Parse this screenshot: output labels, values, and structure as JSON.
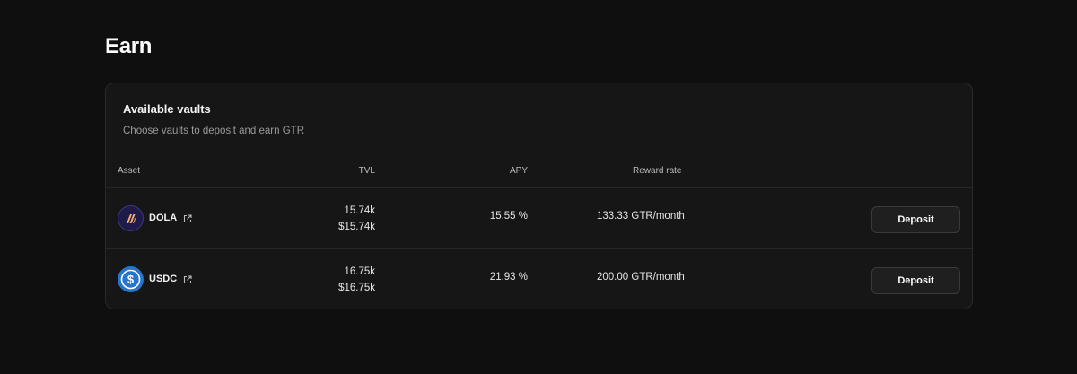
{
  "page": {
    "title": "Earn"
  },
  "vaults": {
    "title": "Available vaults",
    "subtitle": "Choose vaults to deposit and earn GTR",
    "columns": {
      "asset": "Asset",
      "tvl": "TVL",
      "apy": "APY",
      "reward_rate": "Reward rate"
    },
    "rows": [
      {
        "asset": "DOLA",
        "icon": "dola-token-icon",
        "tvl_amount": "15.74k",
        "tvl_usd": "$15.74k",
        "apy": "15.55 %",
        "reward_rate": "133.33 GTR/month",
        "action_label": "Deposit"
      },
      {
        "asset": "USDC",
        "icon": "usdc-token-icon",
        "tvl_amount": "16.75k",
        "tvl_usd": "$16.75k",
        "apy": "21.93 %",
        "reward_rate": "200.00 GTR/month",
        "action_label": "Deposit"
      }
    ]
  },
  "colors": {
    "background": "#0f0f0f",
    "card": "#161616",
    "dola_icon_bg": "#1e1b4b",
    "dola_accent": "#f5b070",
    "usdc_icon_bg": "#2775ca"
  }
}
